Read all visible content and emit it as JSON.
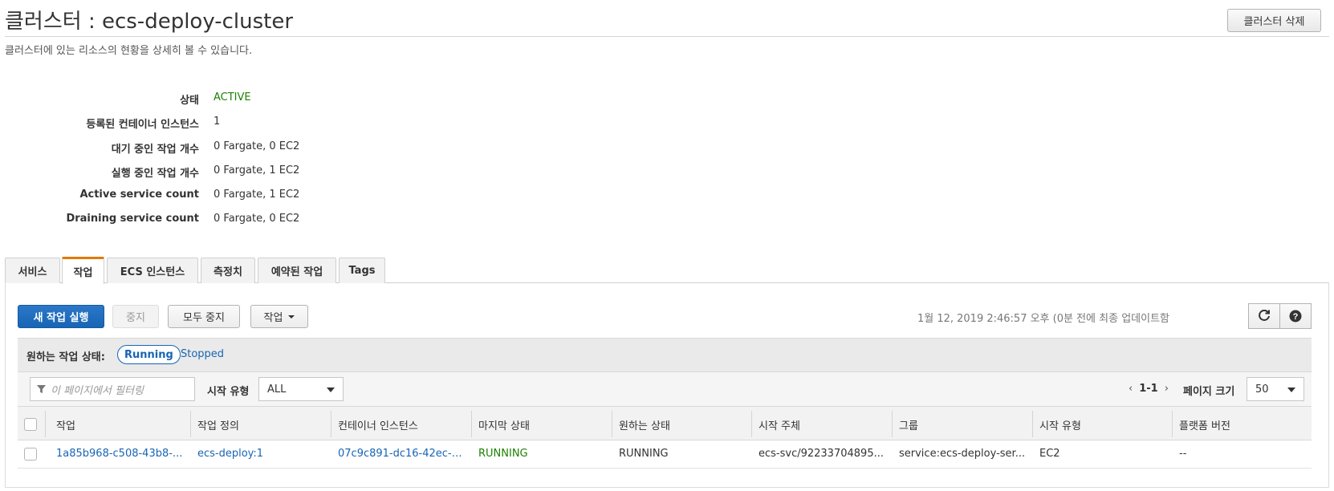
{
  "header": {
    "title": "클러스터 : ecs-deploy-cluster",
    "delete_button": "클러스터 삭제",
    "subtitle": "클러스터에 있는 리소스의 현황을 상세히 볼 수 있습니다."
  },
  "summary": [
    {
      "label": "상태",
      "value": "ACTIVE"
    },
    {
      "label": "등록된 컨테이너 인스턴스",
      "value": "1"
    },
    {
      "label": "대기 중인 작업 개수",
      "value": "0 Fargate, 0 EC2"
    },
    {
      "label": "실행 중인 작업 개수",
      "value": "0 Fargate, 1 EC2"
    },
    {
      "label": "Active service count",
      "value": "0 Fargate, 1 EC2"
    },
    {
      "label": "Draining service count",
      "value": "0 Fargate, 0 EC2"
    }
  ],
  "tabs": [
    {
      "label": "서비스",
      "active": false
    },
    {
      "label": "작업",
      "active": true
    },
    {
      "label": "ECS 인스턴스",
      "active": false
    },
    {
      "label": "측정치",
      "active": false
    },
    {
      "label": "예약된 작업",
      "active": false
    },
    {
      "label": "Tags",
      "active": false
    }
  ],
  "toolbar": {
    "run_new_task": "새 작업 실행",
    "stop": "중지",
    "stop_all": "모두 중지",
    "actions": "작업",
    "last_updated": "1월 12, 2019 2:46:57 오후 (0분 전에 최종 업데이트함",
    "refresh_icon": "refresh-icon",
    "help_icon": "help-icon"
  },
  "filters": {
    "desired_status_label": "원하는 작업 상태:",
    "running": "Running",
    "stopped": "Stopped",
    "filter_placeholder": "이 페이지에서 필터링",
    "launch_type_label": "시작 유형",
    "launch_type_value": "ALL",
    "range": "1-1",
    "page_size_label": "페이지 크기",
    "page_size_value": "50"
  },
  "table": {
    "columns": [
      "작업",
      "작업 정의",
      "컨테이너 인스턴스",
      "마지막 상태",
      "원하는 상태",
      "시작 주체",
      "그룹",
      "시작 유형",
      "플랫폼 버전"
    ],
    "rows": [
      {
        "task": "1a85b968-c508-43b8-...",
        "task_definition": "ecs-deploy:1",
        "container_instance": "07c9c891-dc16-42ec-9...",
        "last_status": "RUNNING",
        "desired_status": "RUNNING",
        "started_by": "ecs-svc/92233704895...",
        "group": "service:ecs-deploy-ser...",
        "launch_type": "EC2",
        "platform_version": "--"
      }
    ]
  },
  "colors": {
    "active_green": "#1d8102",
    "link_blue": "#1765b4",
    "tab_accent": "#e07b00"
  }
}
